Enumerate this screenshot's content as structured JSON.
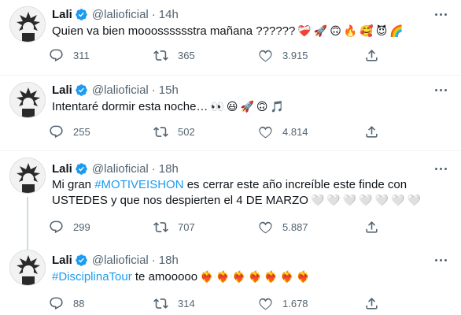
{
  "tweets": [
    {
      "name": "Lali",
      "handle": "@lalioficial",
      "separator": "·",
      "time": "14h",
      "text_lines": [
        {
          "before": "",
          "hashtag": "",
          "after": "Quien va bien mooosssssstra mañana ??????",
          "emojis": [
            "❤‍🩹",
            "🚀",
            "🙃",
            "🔥",
            "🥰",
            "😈",
            "🌈"
          ]
        }
      ],
      "replies": "311",
      "retweets": "365",
      "likes": "3.915"
    },
    {
      "name": "Lali",
      "handle": "@lalioficial",
      "separator": "·",
      "time": "15h",
      "text_lines": [
        {
          "before": "",
          "hashtag": "",
          "after": "Intentaré dormir esta noche…",
          "emojis": [
            "👀",
            "😃",
            "🚀",
            "🙃",
            "🎵"
          ]
        }
      ],
      "replies": "255",
      "retweets": "502",
      "likes": "4.814"
    },
    {
      "name": "Lali",
      "handle": "@lalioficial",
      "separator": "·",
      "time": "18h",
      "text_lines": [
        {
          "before": "Mi gran ",
          "hashtag": "#MOTIVEISHON",
          "after": " es cerrar este año increíble este finde con",
          "emojis": []
        },
        {
          "before": "",
          "hashtag": "",
          "after": "USTEDES y que nos despierten el 4 DE MARZO",
          "emojis": [
            "🤍",
            "🤍",
            "🤍",
            "🤍",
            "🤍",
            "🤍",
            "🤍"
          ]
        }
      ],
      "replies": "299",
      "retweets": "707",
      "likes": "5.887"
    },
    {
      "name": "Lali",
      "handle": "@lalioficial",
      "separator": "·",
      "time": "18h",
      "text_lines": [
        {
          "before": "",
          "hashtag": "#DisciplinaTour",
          "after": " te amooooo",
          "emojis": [
            "❤‍🔥",
            "❤‍🔥",
            "❤‍🔥",
            "❤‍🔥",
            "❤‍🔥",
            "❤‍🔥",
            "❤‍🔥"
          ]
        }
      ],
      "replies": "88",
      "retweets": "314",
      "likes": "1.678"
    }
  ],
  "icons": {
    "verified": "verified-badge-icon",
    "more": "more-icon",
    "reply": "reply-icon",
    "retweet": "retweet-icon",
    "like": "like-icon",
    "share": "share-icon"
  },
  "colors": {
    "accent": "#1d9bf0",
    "muted": "#536471",
    "text": "#0f1419"
  }
}
